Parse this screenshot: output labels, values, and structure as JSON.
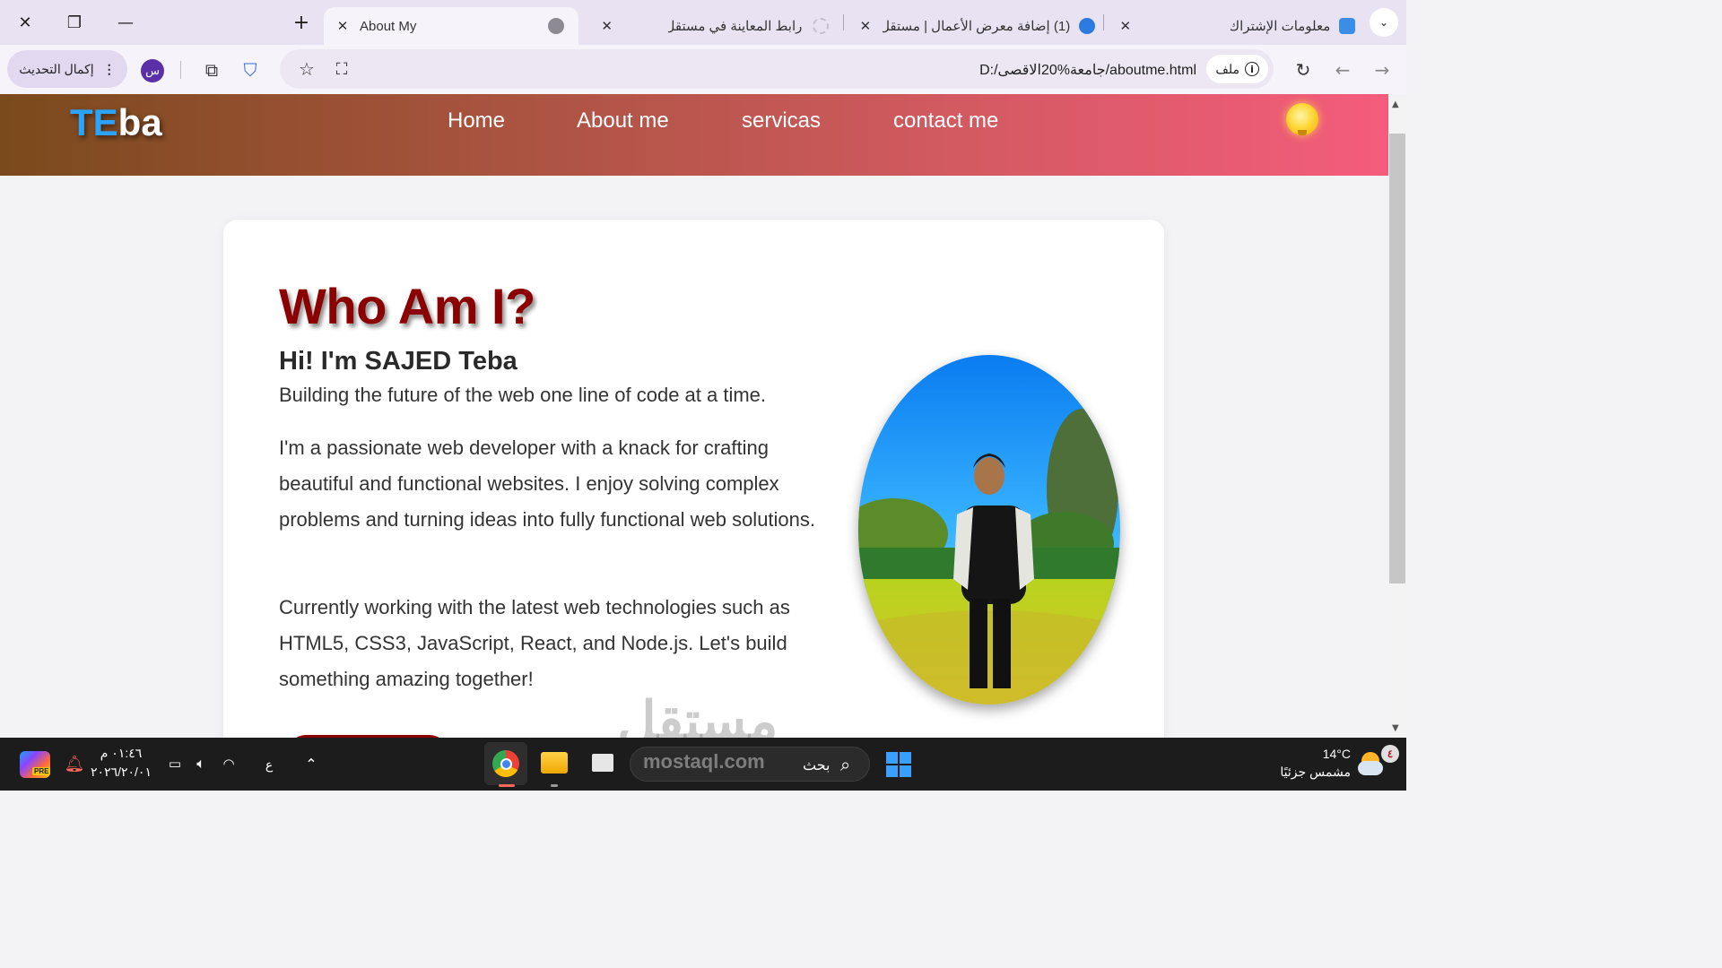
{
  "browser": {
    "tabs": [
      {
        "label": "About My",
        "active": true
      },
      {
        "label": "رابط المعاينة في مستقل",
        "active": false
      },
      {
        "label": "(1) إضافة معرض الأعمال | مستقل",
        "active": false
      },
      {
        "label": "معلومات الإشتراك",
        "active": false
      }
    ],
    "new_tab_icon": "plus-icon",
    "address": {
      "chip_label": "ملف",
      "url": "D:/جامعة%20الاقصى/aboutme.html"
    },
    "update_button_label": "إكمال التحديث",
    "profile_initial": "س"
  },
  "page": {
    "logo_part1": "TE",
    "logo_part2": "ba",
    "nav": [
      "Home",
      "About me",
      "servicas",
      "contact me"
    ],
    "heading": "Who Am I?",
    "intro": "Hi! I'm SAJED Teba",
    "tagline": "Building the future of the web one line of code at a time.",
    "paragraph1": "I'm a passionate web developer with a knack for crafting beautiful and functional websites. I enjoy solving complex problems and turning ideas into fully functional web solutions.",
    "paragraph2": "Currently working with the latest web technologies such as HTML5, CSS3, JavaScript, React, and Node.js. Let's build something amazing together!",
    "colors": {
      "accent": "#8b0000",
      "logo_blue": "#2aa4ff"
    }
  },
  "watermark": {
    "arabic": "مستقل",
    "latin": "mostaql.com"
  },
  "taskbar": {
    "weather_temp": "14°C",
    "weather_desc": "مشمس جزئيًا",
    "weather_badge": "٤",
    "search_label": "بحث",
    "time": "٠١:٤٦ م",
    "date": "٢٠٢٦/٢٠/٠١",
    "lang": "ع",
    "copilot_badge": "PRE"
  }
}
